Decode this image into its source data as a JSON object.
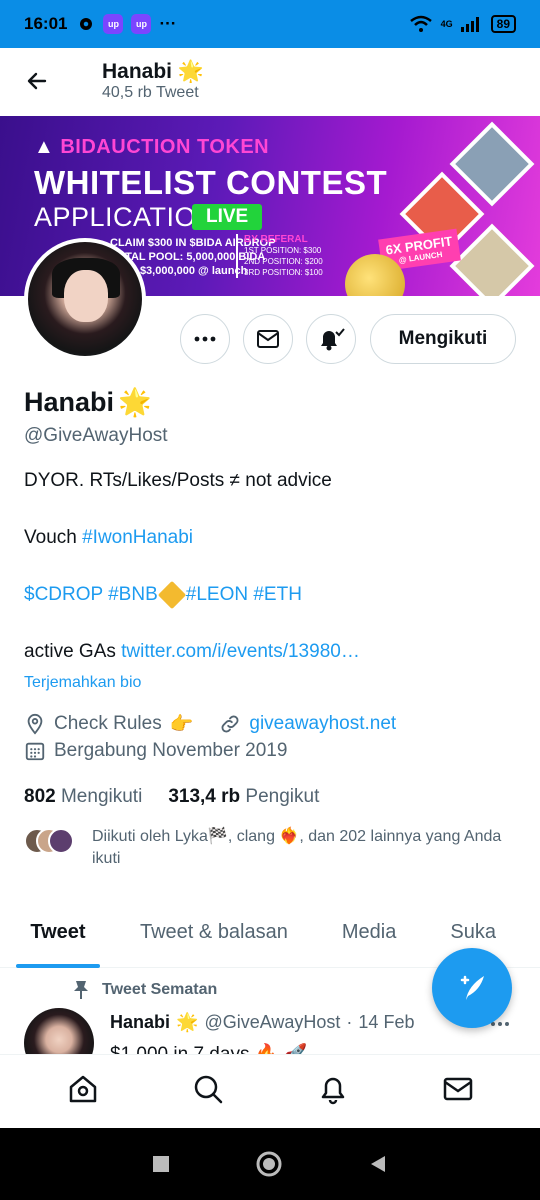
{
  "status_bar": {
    "time": "16:01",
    "badge1": "up",
    "badge2": "up",
    "dots": "···",
    "network": "4G",
    "battery": "89"
  },
  "header": {
    "title": "Hanabi",
    "subtitle": "40,5 rb Tweet"
  },
  "banner": {
    "brand": "BIDAUCTION TOKEN",
    "line1": "WHITELIST CONTEST",
    "line2": "APPLICATION IS",
    "live": "LIVE",
    "airdrop": "CLAIM $300 IN $BIDA AIRDROP",
    "pool": "TOTAL POOL: 5,000,000 BIDA",
    "cap": "CAP: $3,000,000 @ launch",
    "referral_title": "BY REFERAL",
    "pos1": "1ST POSITION: $300",
    "pos2": "2ND POSITION: $200",
    "pos3": "3RD POSITION: $100",
    "profit": "6X PROFIT",
    "profit_sub": "@ LAUNCH"
  },
  "actions": {
    "follow_label": "Mengikuti"
  },
  "profile": {
    "name": "Hanabi",
    "handle": "@GiveAwayHost",
    "bio_line1": "DYOR. RTs/Likes/Posts ≠ not advice",
    "vouch_label": "Vouch",
    "vouch_tag": "#IwonHanabi",
    "tags_a": "$CDROP #BNB",
    "tags_b": "#LEON #ETH",
    "active_label": "active GAs",
    "active_link": "twitter.com/i/events/13980…",
    "translate": "Terjemahkan bio",
    "location": "Check Rules",
    "location_emoji": "👉",
    "website": "giveawayhost.net",
    "joined": "Bergabung November 2019",
    "following_count": "802",
    "following_label": "Mengikuti",
    "followers_count": "313,4 rb",
    "followers_label": "Pengikut",
    "followed_by": "Diikuti oleh Lyka🏁, clang ❤️‍🔥, dan 202 lainnya yang Anda ikuti"
  },
  "tabs": [
    {
      "label": "Tweet"
    },
    {
      "label": "Tweet & balasan"
    },
    {
      "label": "Media"
    },
    {
      "label": "Suka"
    }
  ],
  "pinned_tweet": {
    "label": "Tweet Sematan",
    "author": "Hanabi",
    "handle": "@GiveAwayHost",
    "sep": "·",
    "date": "14 Feb",
    "text": "$1,000 in 7 days 🔥 🚀"
  },
  "colors": {
    "accent": "#1d9bf0",
    "status_bar": "#0a8de6"
  }
}
